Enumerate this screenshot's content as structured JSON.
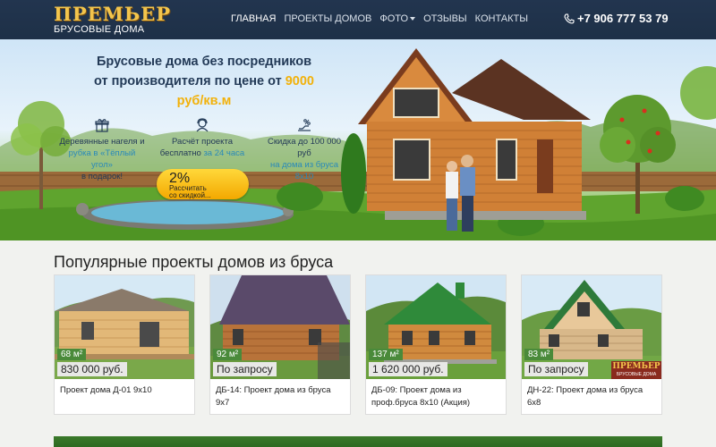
{
  "header": {
    "logo_title": "ПРЕМЬЕР",
    "logo_subtitle": "БРУСОВЫЕ ДОМА",
    "nav": [
      {
        "label": "ГЛАВНАЯ"
      },
      {
        "label": "ПРОЕКТЫ ДОМОВ"
      },
      {
        "label": "ФОТО"
      },
      {
        "label": "ОТЗЫВЫ"
      },
      {
        "label": "КОНТАКТЫ"
      }
    ],
    "phone_icon": "phone-icon",
    "phone": "+7 906 777 53 79"
  },
  "hero": {
    "title_line1": "Брусовые дома без посредников",
    "title_line2": "от производителя по цене от",
    "price": "9000",
    "price_unit": "руб/кв.м",
    "features": [
      {
        "icon": "gift-icon",
        "text": "Деревянные нагеля и",
        "text2": "рубка в «Тёплый",
        "text3": "угол»",
        "text4": "в подарок!"
      },
      {
        "icon": "consultant-icon",
        "text": "Расчёт проекта",
        "text2": "бесплатно",
        "highlight": "за 24 часа"
      },
      {
        "icon": "discount-icon",
        "text": "Скидка до 100 000",
        "text2": "руб",
        "text3": "на дома из бруса",
        "text4": "8х10"
      }
    ],
    "badge_percent": "2%",
    "badge_text1": "Рассчитать",
    "badge_text2": "со скидкой..."
  },
  "section_title": "Популярные проекты домов из бруса",
  "projects": [
    {
      "area": "68 м²",
      "price": "830 000 руб.",
      "title": "Проект дома Д-01 9х10"
    },
    {
      "area": "92 м²",
      "price": "По запросу",
      "title": "ДБ-14: Проект дома из бруса 9х7"
    },
    {
      "area": "137 м²",
      "price": "1 620 000 руб.",
      "title": "ДБ-09: Проект дома из проф.бруса 8х10 (Акция)"
    },
    {
      "area": "83 м²",
      "price": "По запросу",
      "title": "ДН-22: Проект дома из бруса 6х8"
    }
  ],
  "card_logo": "ПРЕМЬЕР",
  "card_logo_sub": "БРУСОВЫЕ ДОМА",
  "colors": {
    "header": "#22354f",
    "accent": "#f2b10a",
    "badge": "#ffc21a",
    "green": "#4a8a3a"
  }
}
